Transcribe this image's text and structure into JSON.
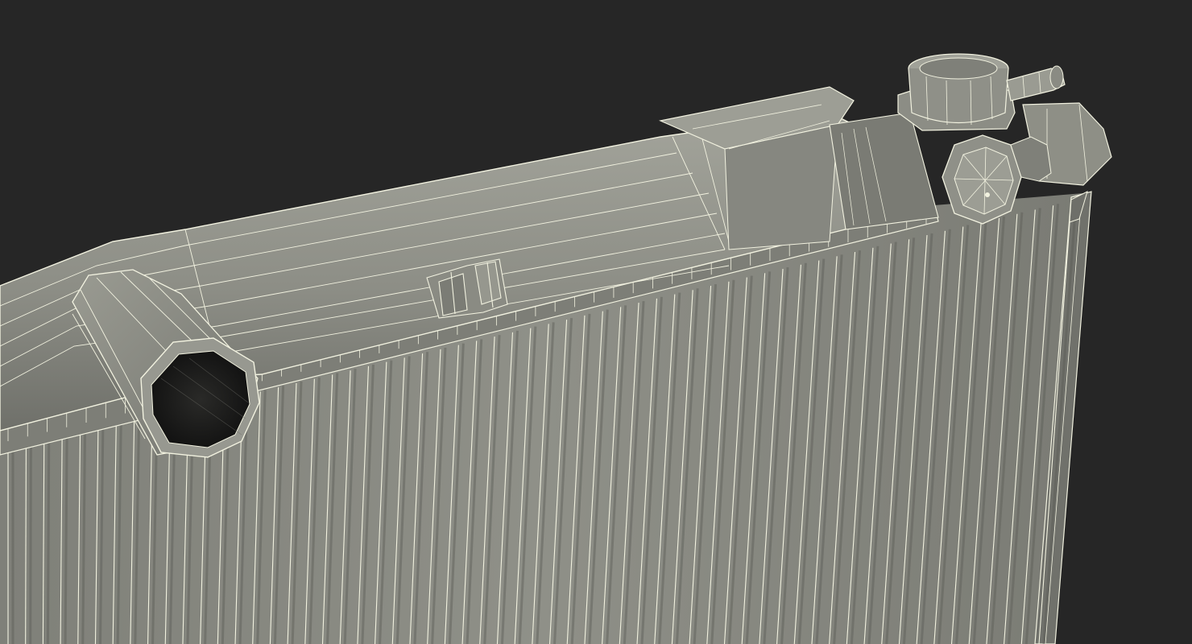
{
  "scene": {
    "subject": "radiator-wireframe-render",
    "background_color": "#262626",
    "surface_color": "#8e8f86",
    "wire_color": "#f2f2e0",
    "shadow_color": "#5c5d57",
    "opening_color": "#151515",
    "fin_count": 60
  }
}
